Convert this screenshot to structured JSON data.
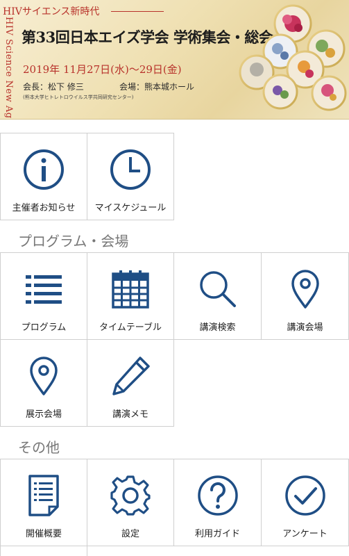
{
  "banner": {
    "tagline": "HIVサイエンス新時代",
    "vertical_text": "HIV Science New Age",
    "title": "第33回日本エイズ学会 学術集会・総会",
    "dates": "2019年 11月27日(水)～29日(金)",
    "president": "会長：松下 修三",
    "venue": "会場：熊本城ホール",
    "organization": "(熊本大学ヒトレトロウイルス学共同研究センター)"
  },
  "top_tiles": [
    {
      "label": "主催者お知らせ",
      "icon": "info-icon"
    },
    {
      "label": "マイスケジュール",
      "icon": "clock-icon"
    }
  ],
  "sections": [
    {
      "title": "プログラム・会場",
      "tiles": [
        {
          "label": "プログラム",
          "icon": "list-icon"
        },
        {
          "label": "タイムテーブル",
          "icon": "calendar-icon"
        },
        {
          "label": "講演検索",
          "icon": "search-icon"
        },
        {
          "label": "講演会場",
          "icon": "map-pin-icon"
        },
        {
          "label": "展示会場",
          "icon": "map-pin-icon"
        },
        {
          "label": "講演メモ",
          "icon": "pencil-icon"
        }
      ]
    },
    {
      "title": "その他",
      "tiles": [
        {
          "label": "開催概要",
          "icon": "document-icon"
        },
        {
          "label": "設定",
          "icon": "gear-icon"
        },
        {
          "label": "利用ガイド",
          "icon": "help-icon"
        },
        {
          "label": "アンケート",
          "icon": "check-circle-icon"
        }
      ]
    }
  ],
  "colors": {
    "icon": "#1f4e85",
    "banner_accent": "#b8322b",
    "tile_border": "#cfcfcf",
    "section_title": "#777777"
  }
}
